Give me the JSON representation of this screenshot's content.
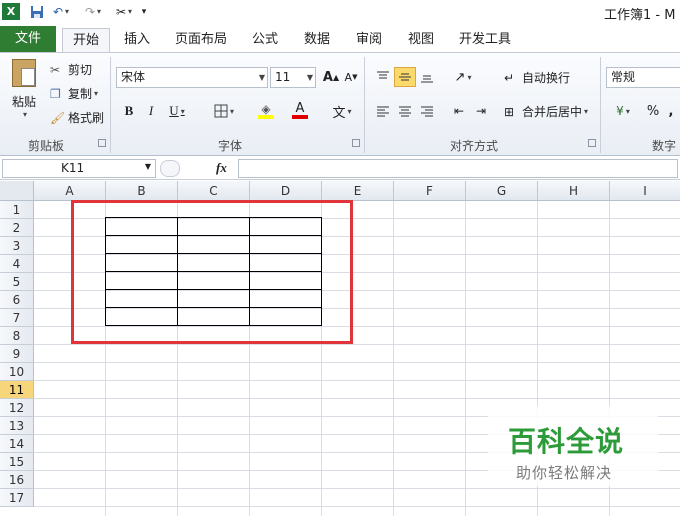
{
  "window": {
    "title": "工作簿1 - M"
  },
  "quick_access": {
    "excel_icon": "excel-logo-icon",
    "save_icon": "save-icon",
    "undo_icon": "undo-icon",
    "redo_icon": "redo-icon",
    "tools_icon": "tools-icon"
  },
  "tabs": [
    {
      "label": "文件"
    },
    {
      "label": "开始"
    },
    {
      "label": "插入"
    },
    {
      "label": "页面布局"
    },
    {
      "label": "公式"
    },
    {
      "label": "数据"
    },
    {
      "label": "审阅"
    },
    {
      "label": "视图"
    },
    {
      "label": "开发工具"
    }
  ],
  "ribbon": {
    "clipboard": {
      "paste": "粘贴",
      "cut": "剪切",
      "copy": "复制",
      "format_painter": "格式刷",
      "group": "剪贴板"
    },
    "font": {
      "name": "宋体",
      "size": "11",
      "bold": "B",
      "italic": "I",
      "underline": "U",
      "grow": "A",
      "shrink": "A",
      "color_letter": "A",
      "phonetic": "文",
      "group": "字体"
    },
    "alignment": {
      "wrap": "自动换行",
      "merge": "合并后居中",
      "group": "对齐方式"
    },
    "number": {
      "format": "常规",
      "percent": "%",
      "comma": ",",
      "group": "数字"
    }
  },
  "formula_bar": {
    "name_box": "K11",
    "fx": "fx",
    "value": ""
  },
  "sheet": {
    "columns": [
      "A",
      "B",
      "C",
      "D",
      "E",
      "F",
      "G",
      "H",
      "I"
    ],
    "rows": [
      "1",
      "2",
      "3",
      "4",
      "5",
      "6",
      "7",
      "8",
      "9",
      "10",
      "11",
      "12",
      "13",
      "14",
      "15",
      "16",
      "17"
    ],
    "selected_row": "11",
    "selected_cell": "K11"
  },
  "watermark": {
    "title": "百科全说",
    "subtitle": "助你轻松解决"
  },
  "colors": {
    "file_tab": "#2e7d32",
    "highlight_box": "#e0333a",
    "selected_row": "#f7d57a",
    "watermark": "#2e9b3b"
  }
}
